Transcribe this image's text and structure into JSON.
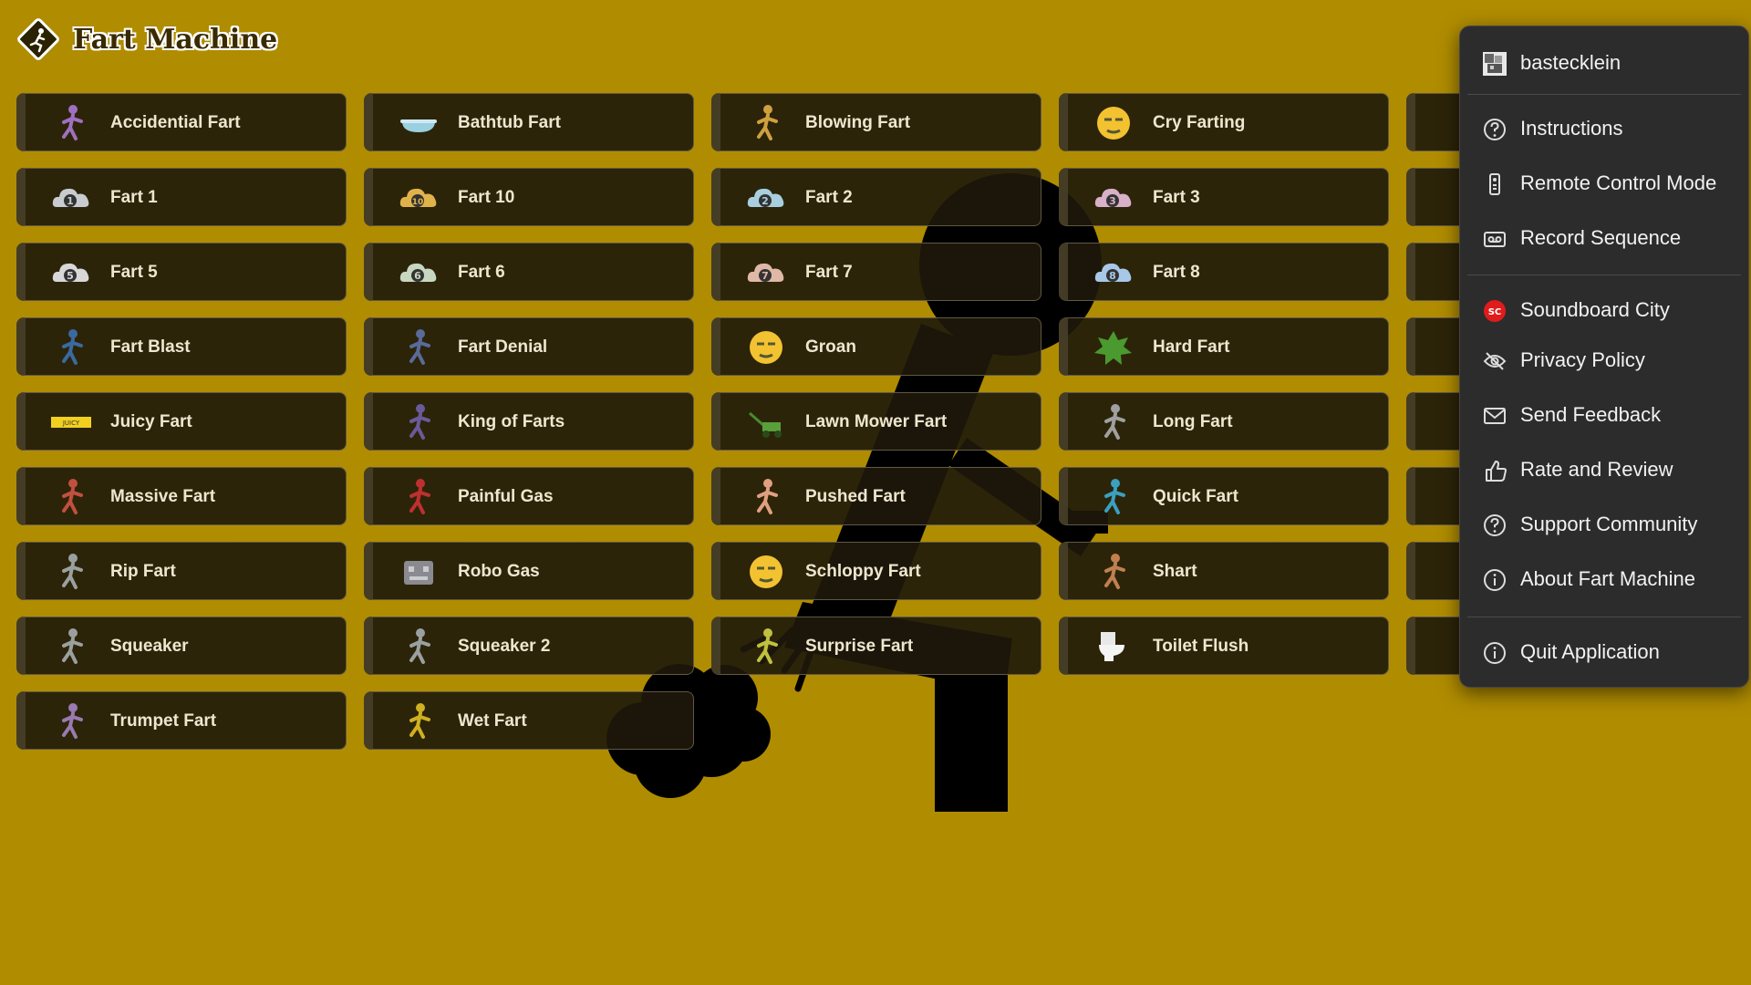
{
  "app": {
    "title": "Fart Machine"
  },
  "sounds": [
    "Accidential Fart",
    "Bathtub Fart",
    "Blowing Fart",
    "Cry Farting",
    "",
    "Fart 1",
    "Fart 10",
    "Fart 2",
    "Fart 3",
    "",
    "Fart 5",
    "Fart 6",
    "Fart 7",
    "Fart 8",
    "",
    "Fart Blast",
    "Fart Denial",
    "Groan",
    "Hard Fart",
    "",
    "Juicy Fart",
    "King of Farts",
    "Lawn Mower Fart",
    "Long Fart",
    "",
    "Massive Fart",
    "Painful Gas",
    "Pushed Fart",
    "Quick Fart",
    "",
    "Rip Fart",
    "Robo Gas",
    "Schloppy Fart",
    "Shart",
    "",
    "Squeaker",
    "Squeaker 2",
    "Surprise Fart",
    "Toilet Flush",
    "",
    "Trumpet Fart",
    "Wet Fart"
  ],
  "tile_icons": [
    "person-at-desk-icon",
    "bathtub-icon",
    "blowing-person-icon",
    "crying-face-icon",
    "partial-icon",
    "cloud-1-icon",
    "cloud-10-icon",
    "cloud-2-icon",
    "cloud-3-icon",
    "partial-cloud-icon",
    "cloud-5-icon",
    "cloud-6-icon",
    "cloud-7-icon",
    "cloud-8-icon",
    "partial-cloud-icon",
    "standing-person-icon",
    "person-shrug-icon",
    "sleepy-face-icon",
    "fart-burst-icon",
    "partial-person-icon",
    "juicy-fruit-sign-icon",
    "dancing-person-icon",
    "lawn-mower-icon",
    "long-fart-icon",
    "partial-icon",
    "massive-cloud-icon",
    "lying-person-icon",
    "pushing-person-icon",
    "running-person-icon",
    "partial-icon",
    "rip-wind-icon",
    "robot-icon",
    "splat-face-icon",
    "shart-person-icon",
    "partial-icon",
    "squeaker-person-icon",
    "squeaker-2-icon",
    "surprised-person-icon",
    "toilet-icon",
    "partial-icon",
    "trumpet-person-icon",
    "wet-person-icon"
  ],
  "cloud_numbers": {
    "Fart 1": "1",
    "Fart 10": "10",
    "Fart 2": "2",
    "Fart 3": "3",
    "Fart 5": "5",
    "Fart 6": "6",
    "Fart 7": "7",
    "Fart 8": "8"
  },
  "menu": {
    "user": "bastecklein",
    "items": [
      {
        "label": "Instructions",
        "icon": "help-circle-icon"
      },
      {
        "label": "Remote Control Mode",
        "icon": "remote-icon"
      },
      {
        "label": "Record Sequence",
        "icon": "record-tape-icon"
      },
      {
        "label": "Soundboard City",
        "icon": "soundboard-city-icon",
        "badge": "SC"
      },
      {
        "label": "Privacy Policy",
        "icon": "eye-slash-icon"
      },
      {
        "label": "Send Feedback",
        "icon": "envelope-icon"
      },
      {
        "label": "Rate and Review",
        "icon": "thumbs-up-icon"
      },
      {
        "label": "Support Community",
        "icon": "help-circle-icon"
      },
      {
        "label": "About Fart Machine",
        "icon": "info-circle-icon"
      },
      {
        "label": "Quit Application",
        "icon": "info-circle-icon"
      }
    ]
  },
  "colors": {
    "background": "#b08c00",
    "tile": "#1e180a",
    "tile_text": "#efe6cf",
    "menu_bg": "#2c2c2c",
    "sc_badge": "#e01b1b"
  }
}
